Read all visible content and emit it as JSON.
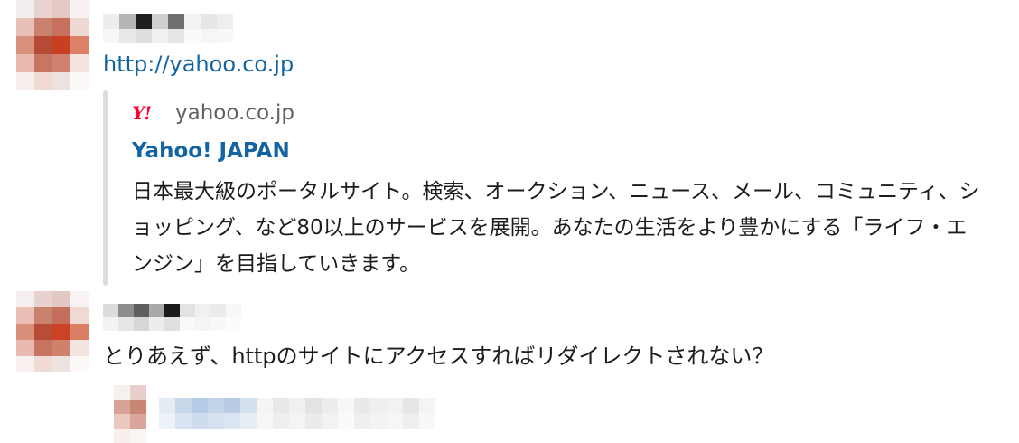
{
  "messages": [
    {
      "avatar_colors": [
        "#f3eeee",
        "#e8d3cf",
        "#e3c9c3",
        "#f7f2f1",
        "#e9c0b7",
        "#c9826e",
        "#c5715e",
        "#eed8d2",
        "#d9907c",
        "#b54b36",
        "#c83f22",
        "#dd8168",
        "#e8b9ae",
        "#c77662",
        "#d0826e",
        "#f4e3de",
        "#f6efed",
        "#efd9d3",
        "#ece3e0",
        "#fbf8f7"
      ],
      "name_colors": [
        "#ededed",
        "#b6b6b6",
        "#1f1f1f",
        "#cfcfcf",
        "#6f6f6f",
        "#f3f3f3",
        "#e6e6e6",
        "#eeeeee",
        "#ffffff",
        "#f7f7f7",
        "#e9e9e9",
        "#dddddd",
        "#f0f0f0",
        "#e5e5e5",
        "#fafafa",
        "#f6f6f6",
        "#f8f8f8",
        "#ffffff"
      ],
      "link_text": "http://yahoo.co.jp",
      "unfurl": {
        "logo_text": "Y!",
        "site_name": "yahoo.co.jp",
        "title": "Yahoo! JAPAN",
        "description": "日本最大級のポータルサイト。検索、オークション、ニュース、メール、コミュニティ、ショッピング、など80以上のサービスを展開。あなたの生活をより豊かにする「ライフ・エンジン」を目指していきます。"
      }
    },
    {
      "avatar_colors": [
        "#f4eeee",
        "#e7d2cd",
        "#e2c8c2",
        "#f8f3f2",
        "#e8beb5",
        "#c9826e",
        "#c36f5c",
        "#efd9d3",
        "#d98f7a",
        "#b84d37",
        "#cc4225",
        "#dc7e64",
        "#e9bbb0",
        "#c67460",
        "#cf816c",
        "#f5e5e0",
        "#f7f0ee",
        "#f0dad4",
        "#ede4e1",
        "#fcf9f8"
      ],
      "name_colors": [
        "#dcdcdc",
        "#8d8d8d",
        "#5f5f5f",
        "#a9a9a9",
        "#1a1a1a",
        "#e3e3e3",
        "#f0f0f0",
        "#ebebeb",
        "#f7f7f7",
        "#ffffff",
        "#f3f3f3",
        "#e6e6e6",
        "#d7d7d7",
        "#ededed",
        "#e0e0e0",
        "#f9f9f9",
        "#f5f5f5",
        "#f8f8f8",
        "#fcfcfc",
        "#ffffff"
      ],
      "text": "とりあえず、httpのサイトにアクセスすればリダイレクトされない？"
    }
  ],
  "reply": {
    "avatar_colors": [
      "#f6f0ef",
      "#e9cfc9",
      "#d8a296",
      "#c98674",
      "#ecc7be",
      "#d9a699",
      "#f8efed",
      "#fbf6f5"
    ],
    "bar_colors": [
      "#e4ebf3",
      "#c6d7ea",
      "#b5cce6",
      "#c2d4e9",
      "#b8cde5",
      "#d4e0ee",
      "#f5f5f5",
      "#e8e8e8",
      "#f0f0f0",
      "#e3e3e3",
      "#ededed",
      "#f7f7f7",
      "#e9e9e9",
      "#efefef",
      "#f2f2f2",
      "#e6e6e6",
      "#f4f4f4",
      "#edf2f8",
      "#d8e4f1",
      "#cfdcee",
      "#d5e1ef",
      "#dbe5f1",
      "#e6edf5",
      "#f7f7f7",
      "#eeeeee",
      "#f4f4f4",
      "#ebebeb",
      "#f2f2f2",
      "#fafafa",
      "#efefef",
      "#f3f3f3",
      "#f6f6f6",
      "#eeeeee",
      "#f8f8f8"
    ]
  }
}
